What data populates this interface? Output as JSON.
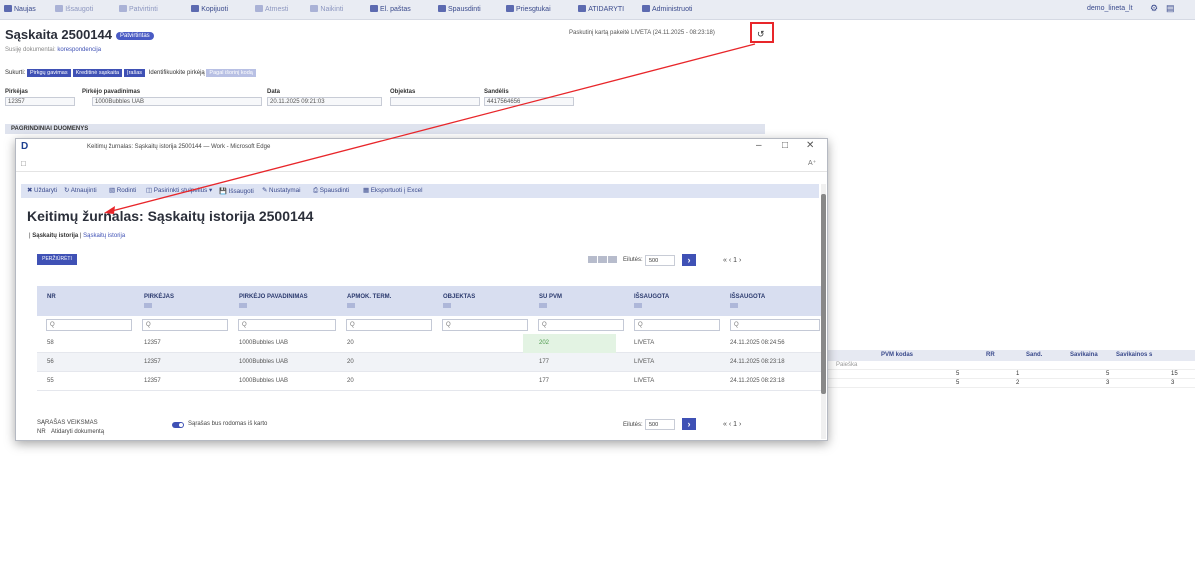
{
  "topbar": {
    "items": [
      {
        "label": "Naujas",
        "dim": false
      },
      {
        "label": "Išsaugoti",
        "dim": true
      },
      {
        "label": "Patvirtinti",
        "dim": true
      },
      {
        "label": "Kopijuoti",
        "dim": false
      },
      {
        "label": "Atmesti",
        "dim": true
      },
      {
        "label": "Naikinti",
        "dim": true
      },
      {
        "label": "El. paštas",
        "dim": false
      },
      {
        "label": "Spausdinti",
        "dim": false
      },
      {
        "label": "Priesgtukai",
        "dim": false
      },
      {
        "label": "ATIDARYTI",
        "dim": false
      },
      {
        "label": "Administruoti",
        "dim": false
      }
    ],
    "user": "demo_lineta_lt"
  },
  "background": {
    "title": "Sąskaita 2500144",
    "status_badge": "Patvirtintas",
    "doc_type_label": "Susiję dokumentai:",
    "doc_type_value": "korespondencija",
    "last_change": "Paskutinį kartą pakeitė LIVETA (24.11.2025 - 08:23:18)",
    "created_label": "Sukurti:",
    "chips": [
      "Pirkgų gavimas",
      "Kreditinė sąskaita",
      "Įrašas"
    ],
    "identify_label": "Identifikuokite pirkėją",
    "chip_light": "Pagal išorinį kodą",
    "fields": {
      "pirkejas_label": "Pirkėjas",
      "pirkejas_value": "12357",
      "pavadinimas_label": "Pirkėjo pavadinimas",
      "pavadinimas_value": "1000Bubbles UAB",
      "data_label": "Data",
      "data_value": "20.11.2025 09:21:03",
      "objektas_label": "Objektas",
      "objektas_value": "",
      "sandelis_label": "Sandėlis",
      "sandelis_value": "4417564656"
    },
    "section": "PAGRINDINIAI DUOMENYS",
    "right_headers": [
      "PVM kodas",
      "RR",
      "Sand.",
      "Savikaina",
      "Savikainos s"
    ],
    "right_filter": "Paieška",
    "right_rows": [
      [
        "5",
        "1",
        "5",
        "15"
      ],
      [
        "5",
        "2",
        "3",
        "3"
      ]
    ]
  },
  "modal": {
    "window_title": "Keitimų žurnalas: Sąskaitų istorija 2500144 — Work - Microsoft Edge",
    "toolbar": [
      "Uždaryti",
      "Atnaujinti",
      "Rodinti",
      "Pasirinkti stulpelius",
      "Išsaugoti",
      "Nustatymai",
      "Spausdinti",
      "Eksportuoti į Excel"
    ],
    "title": "Keitimų žurnalas: Sąskaitų istorija 2500144",
    "link_active": "Sąskaitų istorija",
    "link_other": "Sąskaitų istorija",
    "preview_button": "PERŽIŪRĖTI",
    "rows_label": "Eilutės:",
    "rows_value": "500",
    "pager": "« ‹ 1 ›",
    "columns": [
      "NR",
      "PIRKĖJAS",
      "PIRKĖJO PAVADINIMAS",
      "APMOK. TERM.",
      "OBJEKTAS",
      "SU PVM",
      "IŠSAUGOTA",
      "IŠSAUGOTA"
    ],
    "filter_placeholder": "Q",
    "rows": [
      {
        "nr": "58",
        "pirkejas": "12357",
        "pavadinimas": "1000Bubbles UAB",
        "term": "20",
        "objektas": "",
        "supvm": "202",
        "user": "LIVETA",
        "date": "24.11.2025 08:24:56"
      },
      {
        "nr": "56",
        "pirkejas": "12357",
        "pavadinimas": "1000Bubbles UAB",
        "term": "20",
        "objektas": "",
        "supvm": "177",
        "user": "LIVETA",
        "date": "24.11.2025 08:23:18"
      },
      {
        "nr": "55",
        "pirkejas": "12357",
        "pavadinimas": "1000Bubbles UAB",
        "term": "20",
        "objektas": "",
        "supvm": "177",
        "user": "LIVETA",
        "date": "24.11.2025 08:23:18"
      }
    ],
    "footer_left_1": "SĄRAŠAS VEIKSMAS",
    "footer_left_2a": "NR",
    "footer_left_2b": "Atidaryti dokumentą",
    "toggle_label": "Sąrašas bus rodomas iš karto",
    "footer_rows_label": "Eilutės:",
    "footer_rows_value": "500"
  }
}
